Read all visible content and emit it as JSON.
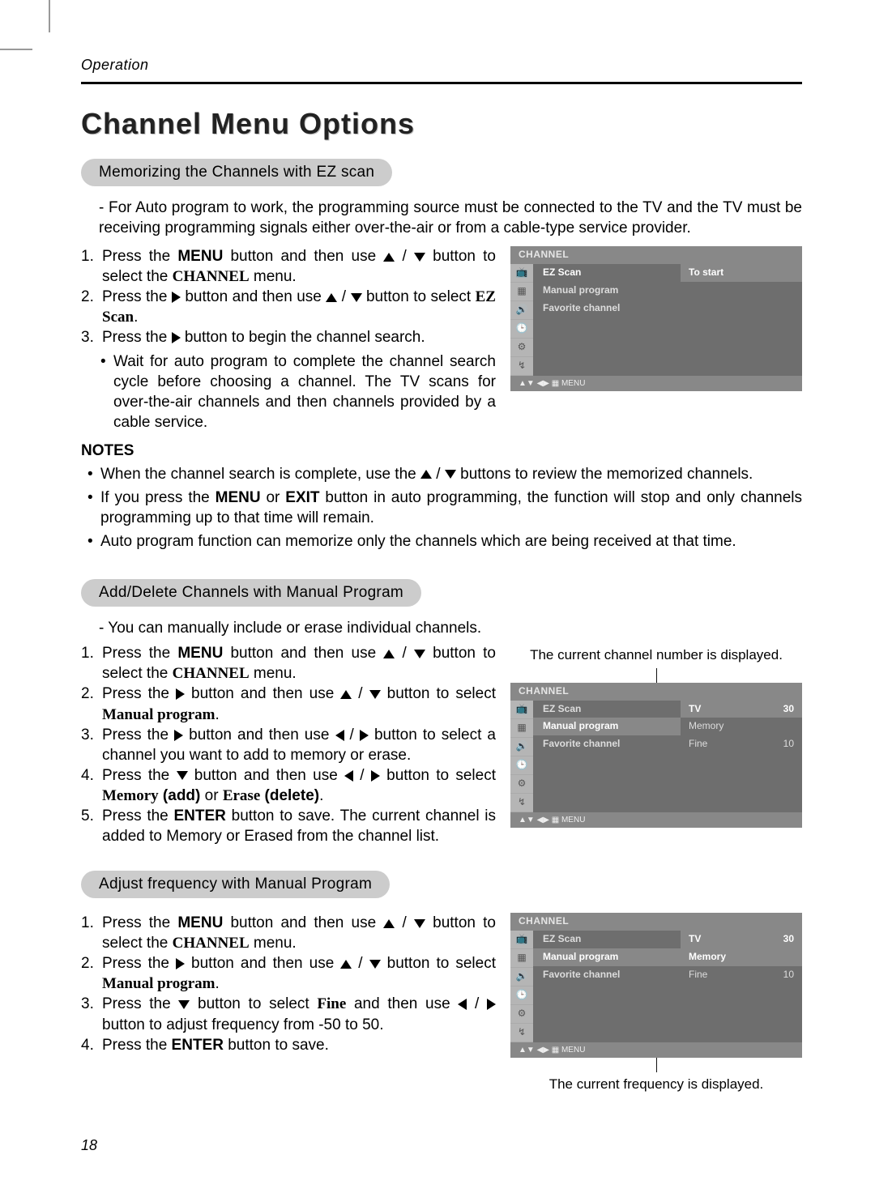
{
  "header": {
    "section": "Operation"
  },
  "title": "Channel Menu Options",
  "labels": {
    "menu": "MENU",
    "exit": "EXIT",
    "enter": "ENTER",
    "notes": "NOTES",
    "channel": "CHANNEL",
    "ezscan": "EZ Scan",
    "manual": "Manual program",
    "memory": "Memory",
    "erase": "Erase",
    "fine": "Fine"
  },
  "s1": {
    "heading": "Memorizing the Channels with EZ scan",
    "intro": "- For Auto program to work, the programming source must be connected to the TV and the TV must be receiving programming signals either over-the-air or from a cable-type service provider.",
    "step3sub": "Wait for auto program to complete the channel search cycle before choosing a channel. The TV scans for over-the-air channels and then channels provided by a cable service.",
    "note3": "Auto program function can memorize only the channels which are being received at that time."
  },
  "s2": {
    "heading": "Add/Delete Channels with Manual Program",
    "intro": "- You can manually include or erase individual channels.",
    "caption": "The current channel number is displayed."
  },
  "s3": {
    "heading": "Adjust frequency with Manual Program",
    "caption": "The current frequency is displayed."
  },
  "osd": {
    "header": "CHANNEL",
    "footer": "MENU",
    "items": [
      "EZ Scan",
      "Manual program",
      "Favorite channel"
    ],
    "right1": [
      {
        "k": "To start",
        "v": ""
      }
    ],
    "right2": [
      {
        "k": "TV",
        "v": "30"
      },
      {
        "k": "Memory",
        "v": ""
      },
      {
        "k": "Fine",
        "v": "10"
      }
    ],
    "right3": [
      {
        "k": "TV",
        "v": "30"
      },
      {
        "k": "Memory",
        "v": ""
      },
      {
        "k": "Fine",
        "v": "10"
      }
    ]
  },
  "page": "18"
}
